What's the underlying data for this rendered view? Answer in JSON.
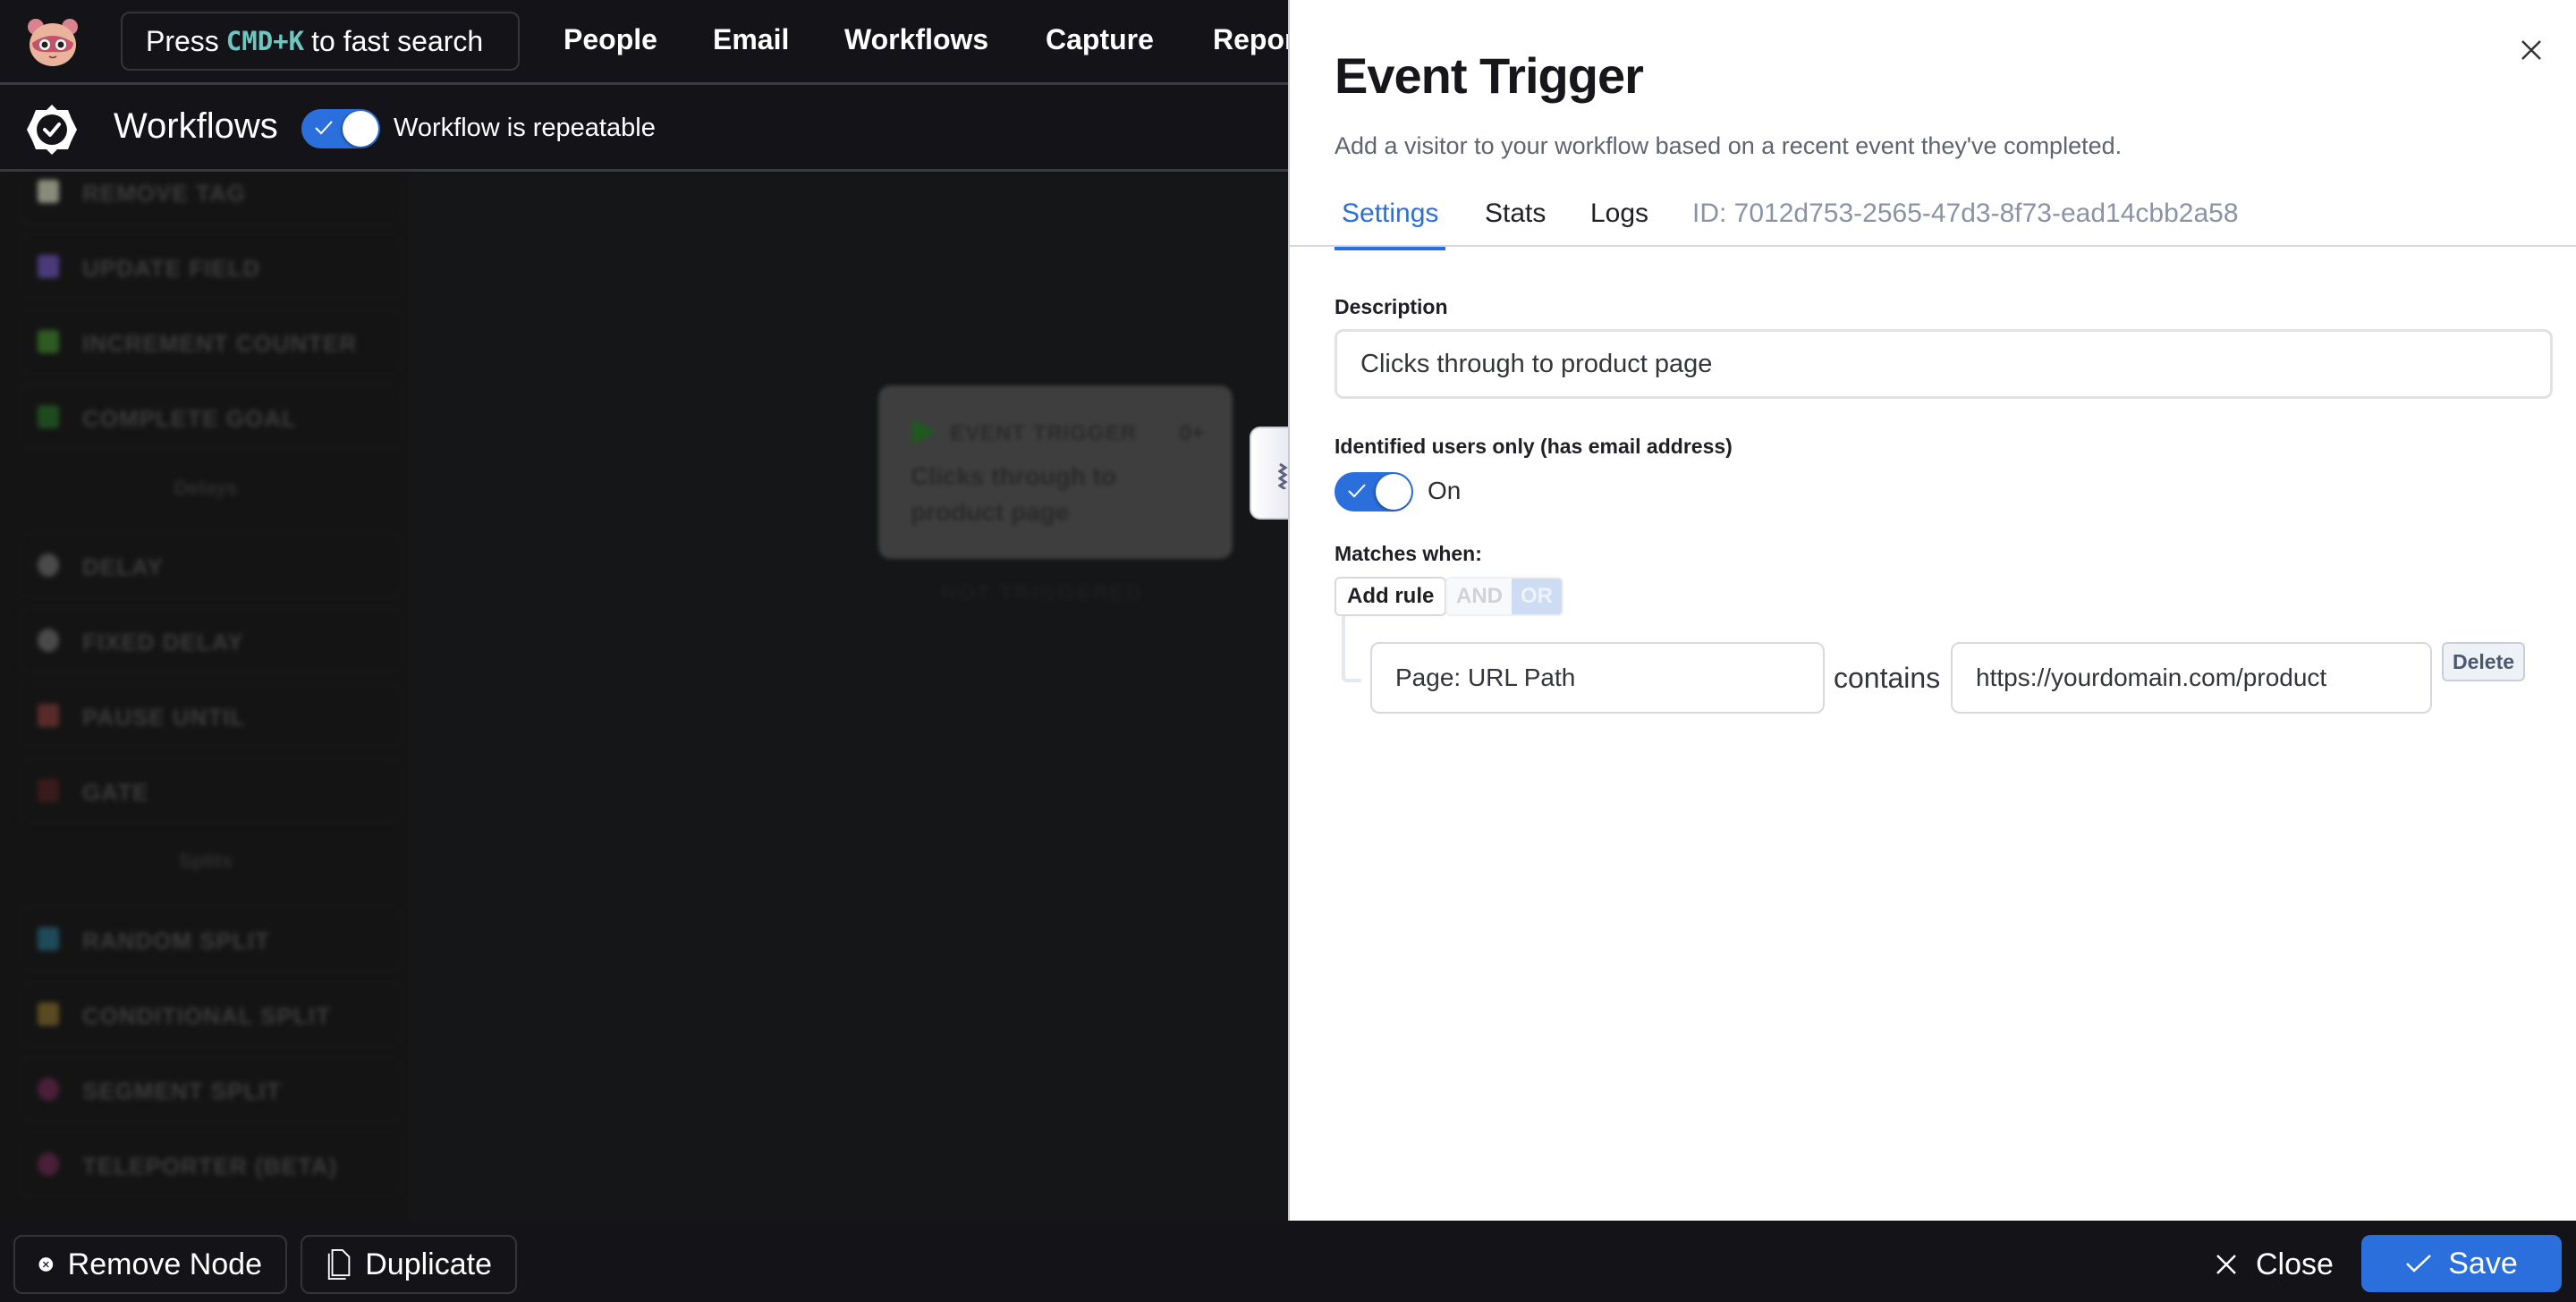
{
  "topnav": {
    "search": {
      "prefix": "Press",
      "shortcut": "CMD+K",
      "suffix": "to fast search"
    },
    "items": [
      "People",
      "Email",
      "Workflows",
      "Capture",
      "Reports"
    ]
  },
  "toolbar": {
    "title": "Workflows",
    "repeatable_toggle": {
      "on": true,
      "label": "Workflow is repeatable"
    }
  },
  "sidebar": {
    "items": [
      {
        "label": "REMOVE TAG",
        "icon": "person-tag-icon",
        "color": "#8a8a7a"
      },
      {
        "label": "UPDATE FIELD",
        "icon": "field-grid-icon",
        "color": "#4a3a7a"
      },
      {
        "label": "INCREMENT COUNTER",
        "icon": "counter-icon",
        "color": "#2f5a22"
      },
      {
        "label": "COMPLETE GOAL",
        "icon": "checkmark-icon",
        "color": "#1f4a1f"
      }
    ],
    "section_delays": "Delays",
    "delay_items": [
      {
        "label": "DELAY",
        "icon": "clock-icon",
        "color": "#4a4a4a"
      },
      {
        "label": "FIXED DELAY",
        "icon": "clock-icon",
        "color": "#4a4a4a"
      },
      {
        "label": "PAUSE UNTIL",
        "icon": "hourglass-icon",
        "color": "#5a2a2a"
      },
      {
        "label": "GATE",
        "icon": "gate-icon",
        "color": "#3a1a1a"
      }
    ],
    "section_splits": "Splits",
    "split_items": [
      {
        "label": "RANDOM SPLIT",
        "icon": "random-split-icon",
        "color": "#1f4a5a"
      },
      {
        "label": "CONDITIONAL SPLIT",
        "icon": "conditional-split-icon",
        "color": "#5a4a22"
      },
      {
        "label": "SEGMENT SPLIT",
        "icon": "segment-split-icon",
        "color": "#4a1f3a"
      },
      {
        "label": "TELEPORTER (BETA)",
        "icon": "teleporter-icon",
        "color": "#4a1f3a"
      }
    ]
  },
  "canvas": {
    "node": {
      "type": "EVENT TRIGGER",
      "count": "0+",
      "description": "Clicks through to product page"
    },
    "status": "NOT TRIGGERED"
  },
  "panel": {
    "title": "Event Trigger",
    "subtitle": "Add a visitor to your workflow based on a recent event they've completed.",
    "tabs": [
      {
        "label": "Settings",
        "active": true
      },
      {
        "label": "Stats",
        "active": false
      },
      {
        "label": "Logs",
        "active": false
      }
    ],
    "id_label": "ID: 7012d753-2565-47d3-8f73-ead14cbb2a58",
    "description_label": "Description",
    "description_value": "Clicks through to product page",
    "identified_label": "Identified users only (has email address)",
    "identified_toggle": {
      "on": true,
      "label": "On"
    },
    "matches_label": "Matches when:",
    "add_rule_label": "Add rule",
    "logic": {
      "and_label": "AND",
      "or_label": "OR",
      "selected": "OR"
    },
    "rules": [
      {
        "field": "Page: URL Path",
        "operator": "contains",
        "value": "https://yourdomain.com/product",
        "delete_label": "Delete"
      }
    ]
  },
  "bottombar": {
    "remove_label": "Remove Node",
    "duplicate_label": "Duplicate",
    "close_label": "Close",
    "save_label": "Save"
  },
  "colors": {
    "accent": "#2b6fdc",
    "dark_bg": "#141418",
    "shortcut": "#6cc7c0"
  }
}
